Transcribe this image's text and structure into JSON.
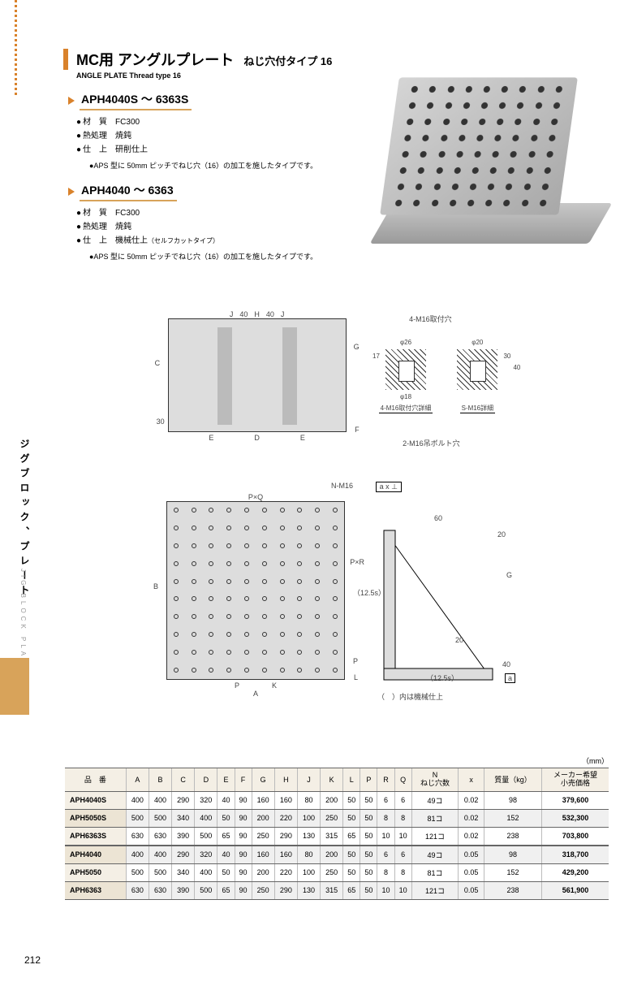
{
  "side": {
    "ja": "ジグブロック、プレート",
    "en": "JIG BLOCK PLATE"
  },
  "title": {
    "main_ja": "MC用 アングルプレート",
    "main_sub": "ねじ穴付タイプ 16",
    "en": "ANGLE PLATE Thread type 16"
  },
  "series1": {
    "name": "APH4040S ～ 6363S",
    "mat_label": "材　質",
    "mat_val": "FC300",
    "heat_label": "熱処理",
    "heat_val": "焼鈍",
    "fin_label": "仕　上",
    "fin_val": "研削仕上",
    "note": "●APS 型に 50mm ピッチでねじ穴（16）の加工を施したタイプです。"
  },
  "series2": {
    "name": "APH4040 ～ 6363",
    "mat_label": "材　質",
    "mat_val": "FC300",
    "heat_label": "熱処理",
    "heat_val": "焼鈍",
    "fin_label": "仕　上",
    "fin_val": "機械仕上",
    "fin_val2": "（セルフカットタイプ）",
    "note": "●APS 型に 50mm ピッチでねじ穴（16）の加工を施したタイプです。"
  },
  "diag": {
    "call_4m16": "4-M16取付穴",
    "call_2m16": "2-M16吊ボルト穴",
    "call_nm16": "N-M16",
    "det1": "4-M16取付穴詳細",
    "det2": "S-M16詳細",
    "phi26": "φ26",
    "phi20": "φ20",
    "phi18": "φ18",
    "n17": "17",
    "n30": "30",
    "n40": "40",
    "n60": "60",
    "n20a": "20",
    "n20b": "20",
    "n40b": "40",
    "n125": "（12.5s）",
    "J": "J",
    "Jb": "J",
    "H": "H",
    "C": "C",
    "G": "G",
    "F": "F",
    "E": "E",
    "Eb": "E",
    "D": "D",
    "A": "A",
    "B": "B",
    "K": "K",
    "L": "L",
    "P": "P",
    "Pb": "P",
    "PxQ": "P×Q",
    "PxR": "P×R",
    "ax": "a x ⊥",
    "a": "a",
    "sub_note": "（　）内は機械仕上"
  },
  "table": {
    "unit": "（mm）",
    "head": {
      "no": "品　番",
      "A": "A",
      "B": "B",
      "C": "C",
      "D": "D",
      "E": "E",
      "F": "F",
      "G": "G",
      "H": "H",
      "J": "J",
      "K": "K",
      "L": "L",
      "P": "P",
      "R": "R",
      "Q": "Q",
      "N1": "N",
      "N2": "ねじ穴数",
      "x": "x",
      "mass": "質量（kg）",
      "price1": "メーカー希望",
      "price2": "小売価格"
    },
    "rows": [
      {
        "no": "APH4040S",
        "A": "400",
        "B": "400",
        "C": "290",
        "D": "320",
        "E": "40",
        "F": "90",
        "G": "160",
        "H": "160",
        "J": "80",
        "K": "200",
        "L": "50",
        "P": "50",
        "R": "6",
        "Q": "6",
        "N": "49コ",
        "x": "0.02",
        "mass": "98",
        "price": "379,600"
      },
      {
        "no": "APH5050S",
        "A": "500",
        "B": "500",
        "C": "340",
        "D": "400",
        "E": "50",
        "F": "90",
        "G": "200",
        "H": "220",
        "J": "100",
        "K": "250",
        "L": "50",
        "P": "50",
        "R": "8",
        "Q": "8",
        "N": "81コ",
        "x": "0.02",
        "mass": "152",
        "price": "532,300"
      },
      {
        "no": "APH6363S",
        "A": "630",
        "B": "630",
        "C": "390",
        "D": "500",
        "E": "65",
        "F": "90",
        "G": "250",
        "H": "290",
        "J": "130",
        "K": "315",
        "L": "65",
        "P": "50",
        "R": "10",
        "Q": "10",
        "N": "121コ",
        "x": "0.02",
        "mass": "238",
        "price": "703,800"
      },
      {
        "no": "APH4040",
        "A": "400",
        "B": "400",
        "C": "290",
        "D": "320",
        "E": "40",
        "F": "90",
        "G": "160",
        "H": "160",
        "J": "80",
        "K": "200",
        "L": "50",
        "P": "50",
        "R": "6",
        "Q": "6",
        "N": "49コ",
        "x": "0.05",
        "mass": "98",
        "price": "318,700",
        "gap": true
      },
      {
        "no": "APH5050",
        "A": "500",
        "B": "500",
        "C": "340",
        "D": "400",
        "E": "50",
        "F": "90",
        "G": "200",
        "H": "220",
        "J": "100",
        "K": "250",
        "L": "50",
        "P": "50",
        "R": "8",
        "Q": "8",
        "N": "81コ",
        "x": "0.05",
        "mass": "152",
        "price": "429,200"
      },
      {
        "no": "APH6363",
        "A": "630",
        "B": "630",
        "C": "390",
        "D": "500",
        "E": "65",
        "F": "90",
        "G": "250",
        "H": "290",
        "J": "130",
        "K": "315",
        "L": "65",
        "P": "50",
        "R": "10",
        "Q": "10",
        "N": "121コ",
        "x": "0.05",
        "mass": "238",
        "price": "561,900"
      }
    ]
  },
  "page_no": "212"
}
